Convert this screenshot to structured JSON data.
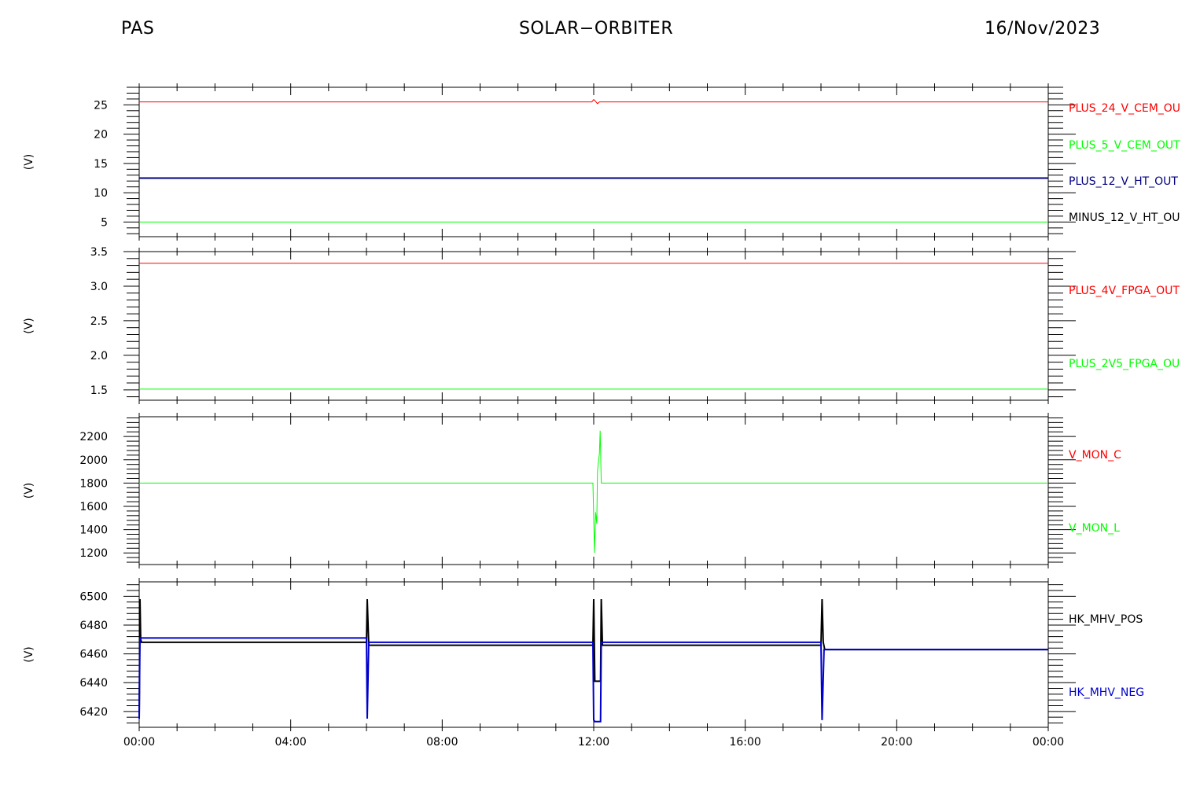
{
  "header": {
    "left": "PAS",
    "center": "SOLAR−ORBITER",
    "right": "16/Nov/2023"
  },
  "chart_data": [
    {
      "type": "line",
      "ylabel": "(V)",
      "ylim": [
        2.5,
        28
      ],
      "yticks": [
        5,
        10,
        15,
        20,
        25
      ],
      "ytick_labels": [
        "5",
        "10",
        "15",
        "20",
        "25"
      ],
      "xlim": [
        0,
        24
      ],
      "legend_placement": "right",
      "series": [
        {
          "name": "PLUS_24_V_CEM_OU",
          "color": "#ff0000",
          "width": 1,
          "x": [
            0,
            11.95,
            12.0,
            12.05,
            12.1,
            12.15,
            12.2,
            24
          ],
          "y": [
            25.5,
            25.5,
            25.9,
            25.6,
            25.2,
            25.5,
            25.5,
            25.5
          ]
        },
        {
          "name": "PLUS_5_V_CEM_OUT",
          "color": "#00ff00",
          "width": 1,
          "x": [
            0,
            24
          ],
          "y": [
            5.0,
            5.0
          ]
        },
        {
          "name": "PLUS_12_V_HT_OUT",
          "color": "#000080",
          "width": 2,
          "x": [
            0,
            24
          ],
          "y": [
            12.5,
            12.5
          ]
        },
        {
          "name": "MINUS_12_V_HT_OU",
          "color": "#000000",
          "width": 1,
          "x": [],
          "y": []
        }
      ]
    },
    {
      "type": "line",
      "ylabel": "(V)",
      "ylim": [
        1.35,
        3.5
      ],
      "yticks": [
        1.5,
        2.0,
        2.5,
        3.0,
        3.5
      ],
      "ytick_labels": [
        "1.5",
        "2.0",
        "2.5",
        "3.0",
        "3.5"
      ],
      "xlim": [
        0,
        24
      ],
      "legend_placement": "right",
      "series": [
        {
          "name": "PLUS_4V_FPGA_OUT",
          "color": "#ff0000",
          "width": 1,
          "x": [
            0,
            24
          ],
          "y": [
            3.33,
            3.33
          ]
        },
        {
          "name": "PLUS_2V5_FPGA_OU",
          "color": "#00ff00",
          "width": 1,
          "x": [
            0,
            24
          ],
          "y": [
            1.51,
            1.51
          ]
        }
      ]
    },
    {
      "type": "line",
      "ylabel": "(V)",
      "ylim": [
        1100,
        2370
      ],
      "yticks": [
        1200,
        1400,
        1600,
        1800,
        2000,
        2200
      ],
      "ytick_labels": [
        "1200",
        "1400",
        "1600",
        "1800",
        "2000",
        "2200"
      ],
      "xlim": [
        0,
        24
      ],
      "legend_placement": "right",
      "series": [
        {
          "name": "V_MON_C",
          "color": "#ff0000",
          "width": 1,
          "x": [],
          "y": []
        },
        {
          "name": "V_MON_L",
          "color": "#00ff00",
          "width": 1,
          "x": [
            0,
            11.98,
            12.02,
            12.05,
            12.08,
            12.1,
            12.13,
            12.15,
            12.17,
            12.2,
            24
          ],
          "y": [
            1800,
            1800,
            1200,
            1550,
            1450,
            1900,
            2000,
            2050,
            2250,
            1800,
            1800
          ]
        }
      ]
    },
    {
      "type": "line",
      "ylabel": "(V)",
      "ylim": [
        6409,
        6510
      ],
      "yticks": [
        6420,
        6440,
        6460,
        6480,
        6500
      ],
      "ytick_labels": [
        "6420",
        "6440",
        "6460",
        "6480",
        "6500"
      ],
      "xlim": [
        0,
        24
      ],
      "xticks": [
        0,
        4,
        8,
        12,
        16,
        20,
        24
      ],
      "xtick_labels": [
        "00:00",
        "04:00",
        "08:00",
        "12:00",
        "16:00",
        "20:00",
        "00:00"
      ],
      "legend_placement": "right",
      "series": [
        {
          "name": "HK_MHV_POS",
          "color": "#000000",
          "width": 2,
          "x": [
            0,
            0.02,
            0.04,
            0.06,
            6.0,
            6.02,
            6.06,
            6.1,
            11.98,
            12.0,
            12.03,
            12.06,
            12.18,
            12.2,
            12.23,
            18.0,
            18.03,
            18.06,
            18.1,
            24
          ],
          "y": [
            6415,
            6498,
            6470,
            6468,
            6468,
            6498,
            6466,
            6466,
            6466,
            6498,
            6441,
            6441,
            6441,
            6498,
            6466,
            6466,
            6498,
            6468,
            6463,
            6463
          ]
        },
        {
          "name": "HK_MHV_NEG",
          "color": "#0000cc",
          "width": 2,
          "x": [
            0,
            0.02,
            0.04,
            6.0,
            6.02,
            6.06,
            11.98,
            12.0,
            12.03,
            12.18,
            12.2,
            12.23,
            18.0,
            18.03,
            18.08,
            24
          ],
          "y": [
            6415,
            6471,
            6471,
            6471,
            6415,
            6468,
            6468,
            6414,
            6413,
            6413,
            6468,
            6468,
            6468,
            6414,
            6463,
            6463
          ]
        }
      ]
    }
  ]
}
